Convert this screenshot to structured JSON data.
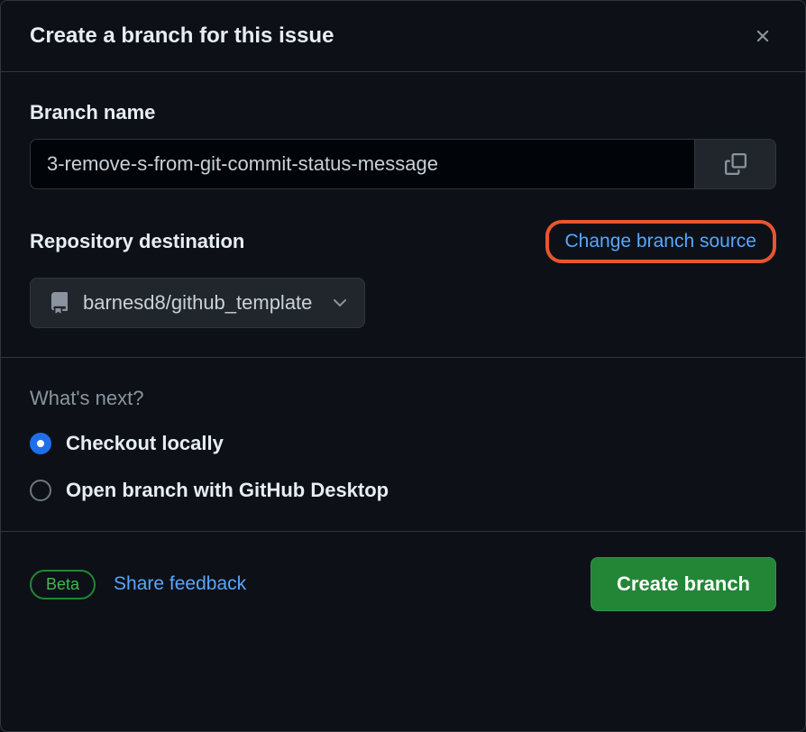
{
  "header": {
    "title": "Create a branch for this issue"
  },
  "branch": {
    "label": "Branch name",
    "value": "3-remove-s-from-git-commit-status-message"
  },
  "repo": {
    "label": "Repository destination",
    "change_source": "Change branch source",
    "selected": "barnesd8/github_template"
  },
  "next": {
    "label": "What's next?",
    "options": [
      {
        "label": "Checkout locally",
        "checked": true
      },
      {
        "label": "Open branch with GitHub Desktop",
        "checked": false
      }
    ]
  },
  "footer": {
    "badge": "Beta",
    "feedback": "Share feedback",
    "submit": "Create branch"
  }
}
